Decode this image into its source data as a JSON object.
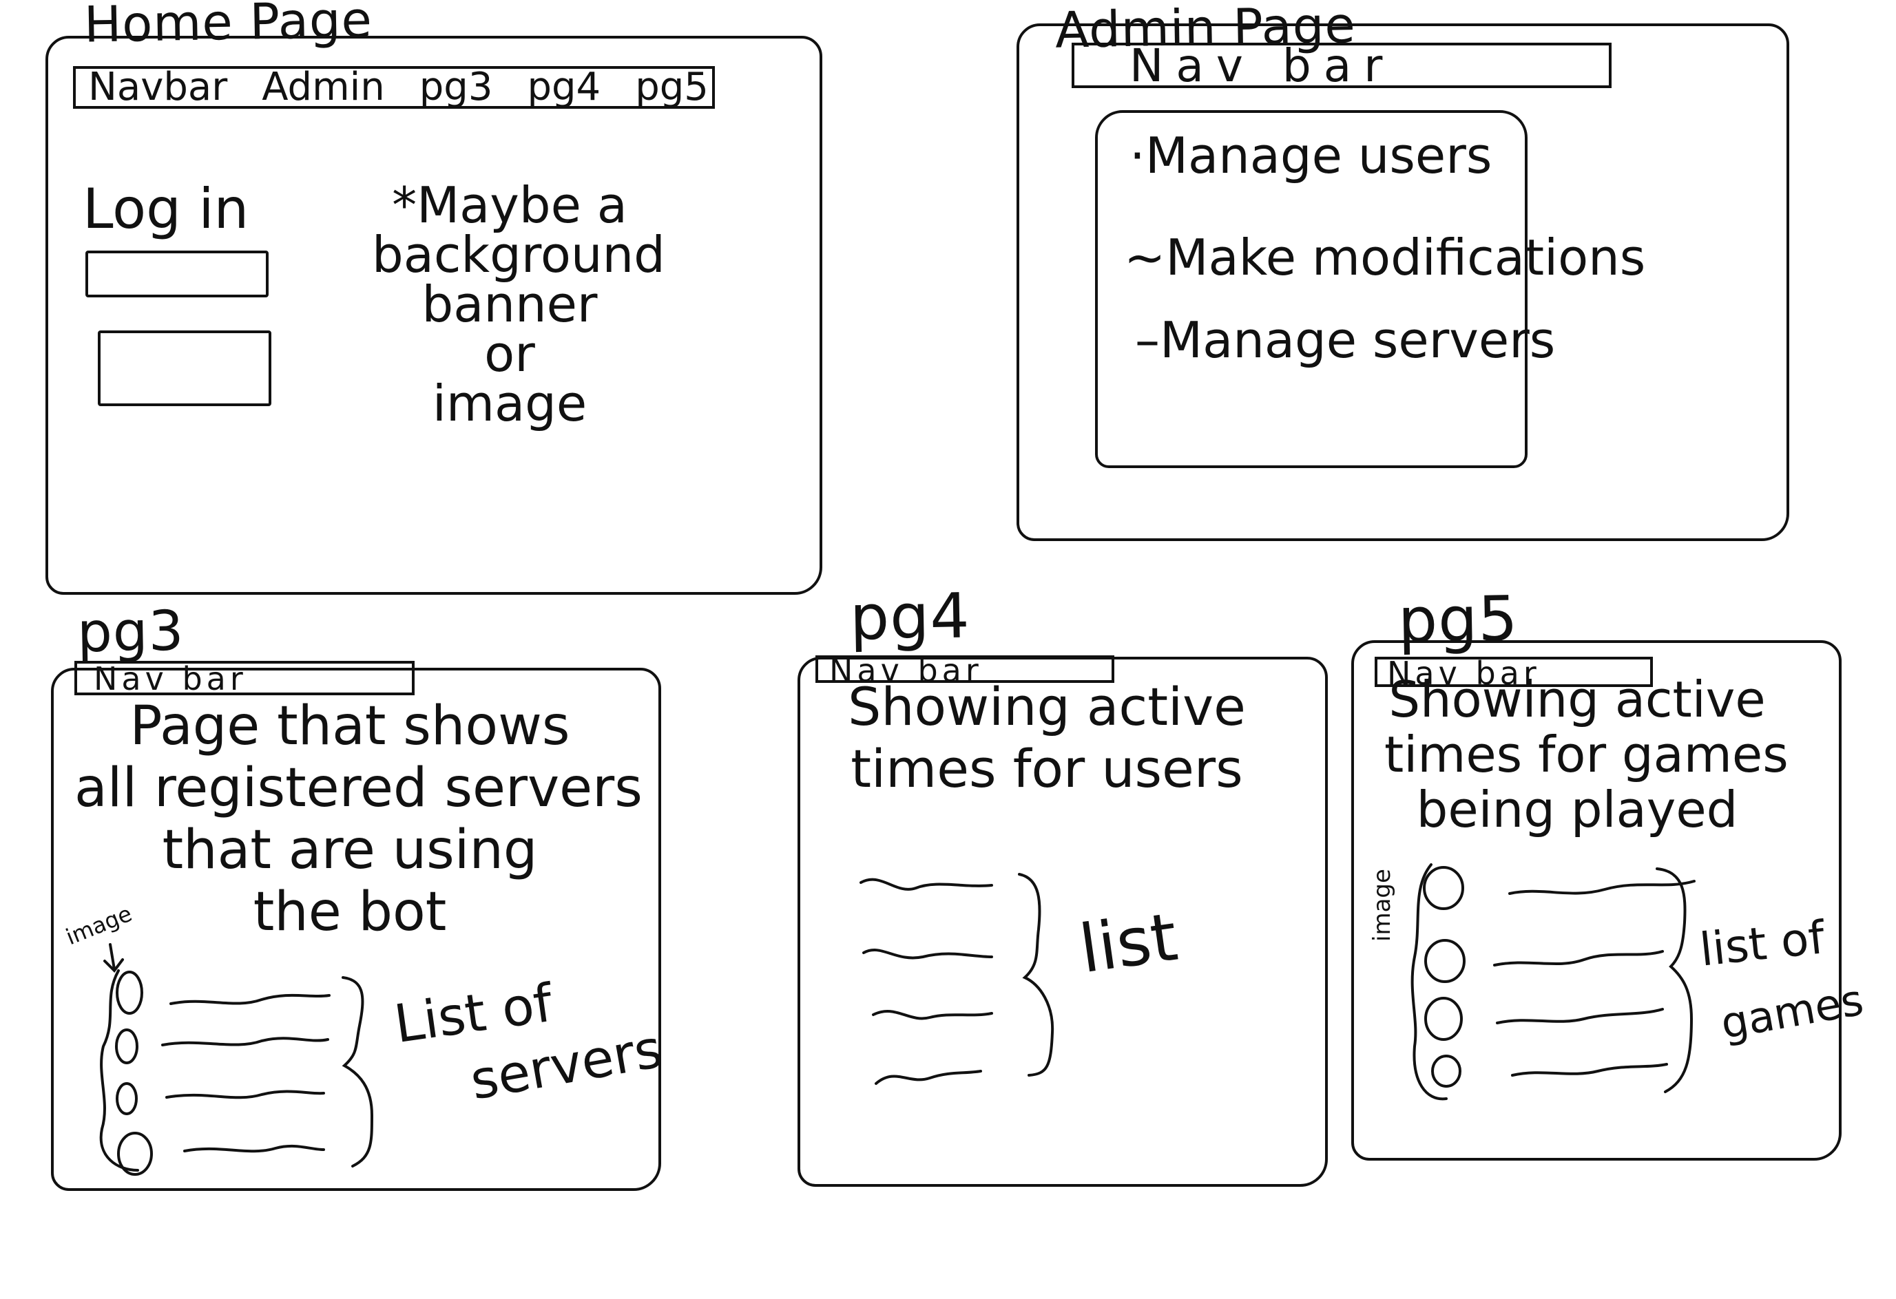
{
  "home": {
    "title": "Home Page",
    "navbar": [
      "Navbar",
      "Admin",
      "pg3",
      "pg4",
      "pg5"
    ],
    "login_label": "Log in",
    "note_lines": [
      "*Maybe a",
      "background",
      "banner",
      "or",
      "image"
    ]
  },
  "admin": {
    "title": "Admin Page",
    "navbar_label": "Nav bar",
    "items": [
      "·Manage users",
      "~Make modifications",
      "–Manage servers"
    ]
  },
  "pg3": {
    "title": "pg3",
    "navbar_label": "Nav bar",
    "description_lines": [
      "Page that shows",
      "all registered servers",
      "that are using",
      "the bot"
    ],
    "image_label": "image",
    "list_label_lines": [
      "List of",
      "servers"
    ]
  },
  "pg4": {
    "title": "pg4",
    "navbar_label": "Nav bar",
    "description_lines": [
      "Showing active",
      "times for users"
    ],
    "list_label": "list"
  },
  "pg5": {
    "title": "pg5",
    "navbar_label": "Nav bar",
    "description_lines": [
      "Showing active",
      "times for games",
      "being played"
    ],
    "image_label": "image",
    "list_label_lines": [
      "list of",
      "games"
    ]
  }
}
